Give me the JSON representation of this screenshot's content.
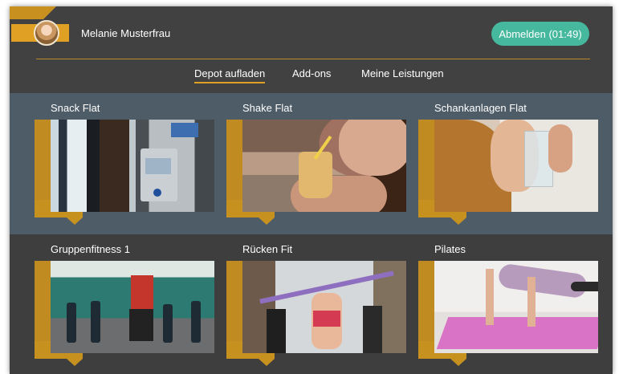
{
  "header": {
    "user_name": "Melanie Musterfrau",
    "logout_label": "Abmelden (01:49)"
  },
  "tabs": [
    {
      "label": "Depot aufladen",
      "active": true
    },
    {
      "label": "Add-ons",
      "active": false
    },
    {
      "label": "Meine Leistungen",
      "active": false
    }
  ],
  "cards": [
    {
      "title": "Snack Flat",
      "image": "vending-machine"
    },
    {
      "title": "Shake Flat",
      "image": "woman-drinking-shake"
    },
    {
      "title": "Schankanlagen Flat",
      "image": "woman-drinking-water"
    },
    {
      "title": "Gruppenfitness 1",
      "image": "group-fitness-class"
    },
    {
      "title": "Rücken Fit",
      "image": "resistance-band-class"
    },
    {
      "title": "Pilates",
      "image": "pilates-on-mat"
    }
  ],
  "colors": {
    "background": "#414141",
    "row_highlight": "#4e5c67",
    "accent_gold": "#e0a024",
    "logout_green": "#46b89e"
  }
}
